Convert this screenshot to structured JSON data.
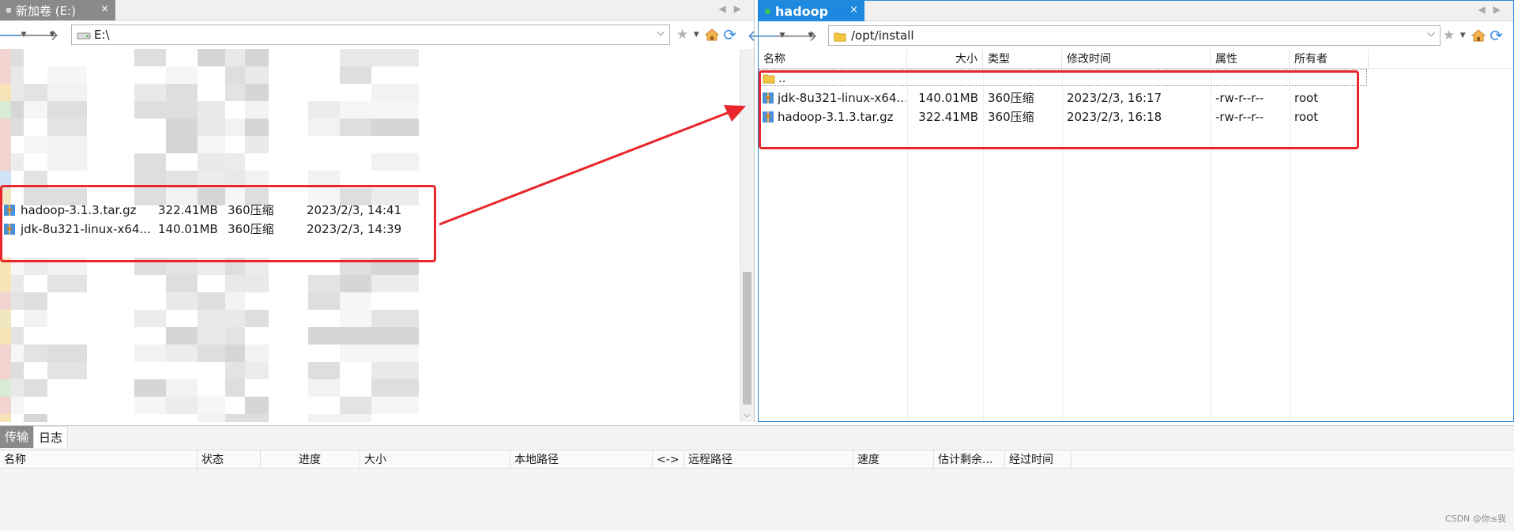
{
  "left_pane": {
    "tab_label": "新加卷 (E:)",
    "tab_close": "×",
    "path": "E:\\",
    "files": [
      {
        "name": "hadoop-3.1.3.tar.gz",
        "size": "322.41MB",
        "type": "360压缩",
        "modified": "2023/2/3, 14:41"
      },
      {
        "name": "jdk-8u321-linux-x64...",
        "size": "140.01MB",
        "type": "360压缩",
        "modified": "2023/2/3, 14:39"
      }
    ]
  },
  "right_pane": {
    "tab_label": "hadoop",
    "tab_close": "×",
    "path": "/opt/install",
    "columns": {
      "name": "名称",
      "size": "大小",
      "type": "类型",
      "modified": "修改时间",
      "attr": "属性",
      "owner": "所有者"
    },
    "parent_dir": "..",
    "files": [
      {
        "name": "jdk-8u321-linux-x64...",
        "size": "140.01MB",
        "type": "360压缩",
        "modified": "2023/2/3, 16:17",
        "attr": "-rw-r--r--",
        "owner": "root"
      },
      {
        "name": "hadoop-3.1.3.tar.gz",
        "size": "322.41MB",
        "type": "360压缩",
        "modified": "2023/2/3, 16:18",
        "attr": "-rw-r--r--",
        "owner": "root"
      }
    ]
  },
  "transfer": {
    "tabs": [
      "传输",
      "日志"
    ],
    "columns": [
      "名称",
      "状态",
      "进度",
      "大小",
      "本地路径",
      "<->",
      "远程路径",
      "速度",
      "估计剩余...",
      "经过时间"
    ]
  },
  "watermark": "CSDN @你≤我",
  "colors": {
    "accent": "#1c88e0",
    "highlight": "#e8262b",
    "tab_inactive": "#8a8a8a"
  },
  "icons": {
    "back": "arrow-left-icon",
    "forward": "arrow-right-icon",
    "bookmark": "star-icon",
    "home": "home-icon",
    "refresh": "refresh-icon",
    "archive": "archive-file-icon",
    "folder": "folder-icon",
    "drive": "drive-icon"
  }
}
